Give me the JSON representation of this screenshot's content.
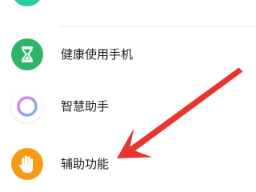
{
  "settings_list": {
    "items": [
      {
        "label": "健康使用手机",
        "icon": "hourglass-icon",
        "icon_color": "#2fb56a"
      },
      {
        "label": "智慧助手",
        "icon": "assistant-ring-icon",
        "icon_color": "#b58cf0"
      },
      {
        "label": "辅助功能",
        "icon": "hand-icon",
        "icon_color": "#f59b17"
      }
    ]
  },
  "annotation": {
    "arrow_color": "#e8352e"
  }
}
